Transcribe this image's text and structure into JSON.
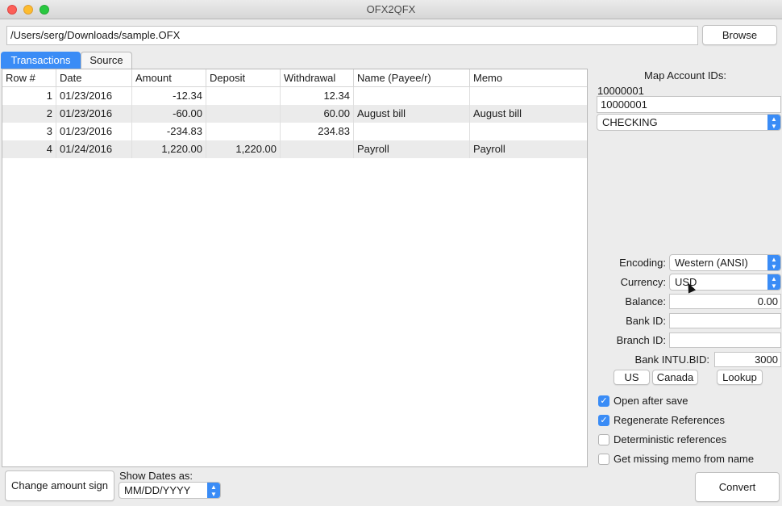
{
  "window": {
    "title": "OFX2QFX"
  },
  "file": {
    "path": "/Users/serg/Downloads/sample.OFX",
    "browse_label": "Browse"
  },
  "tabs": [
    {
      "label": "Transactions",
      "active": true
    },
    {
      "label": "Source",
      "active": false
    }
  ],
  "table": {
    "columns": [
      "Row #",
      "Date",
      "Amount",
      "Deposit",
      "Withdrawal",
      "Name (Payee/r)",
      "Memo"
    ],
    "rows": [
      {
        "row": "1",
        "date": "01/23/2016",
        "amount": "-12.34",
        "deposit": "",
        "withdrawal": "12.34",
        "name": "",
        "memo": ""
      },
      {
        "row": "2",
        "date": "01/23/2016",
        "amount": "-60.00",
        "deposit": "",
        "withdrawal": "60.00",
        "name": "August bill",
        "memo": "August bill"
      },
      {
        "row": "3",
        "date": "01/23/2016",
        "amount": "-234.83",
        "deposit": "",
        "withdrawal": "234.83",
        "name": "",
        "memo": ""
      },
      {
        "row": "4",
        "date": "01/24/2016",
        "amount": "1,220.00",
        "deposit": "1,220.00",
        "withdrawal": "",
        "name": "Payroll",
        "memo": "Payroll"
      }
    ]
  },
  "map_accounts": {
    "title": "Map Account IDs:",
    "source_id": "10000001",
    "target_id": "10000001",
    "account_type": "CHECKING"
  },
  "settings": {
    "encoding_label": "Encoding:",
    "encoding_value": "Western (ANSI)",
    "currency_label": "Currency:",
    "currency_value": "USD",
    "balance_label": "Balance:",
    "balance_value": "0.00",
    "bank_id_label": "Bank ID:",
    "bank_id_value": "",
    "branch_id_label": "Branch ID:",
    "branch_id_value": "",
    "intu_bid_label": "Bank INTU.BID:",
    "intu_bid_value": "3000",
    "us_label": "US",
    "canada_label": "Canada",
    "lookup_label": "Lookup"
  },
  "options": [
    {
      "label": "Open after save",
      "checked": true
    },
    {
      "label": "Regenerate References",
      "checked": true
    },
    {
      "label": "Deterministic references",
      "checked": false
    },
    {
      "label": "Get missing memo from name",
      "checked": false
    }
  ],
  "footer": {
    "change_sign_label": "Change amount sign",
    "show_dates_label": "Show Dates as:",
    "date_format": "MM/DD/YYYY",
    "convert_label": "Convert"
  },
  "colors": {
    "accent": "#3a8cf6",
    "alt_row": "#ebebeb",
    "window_bg": "#ececec"
  }
}
